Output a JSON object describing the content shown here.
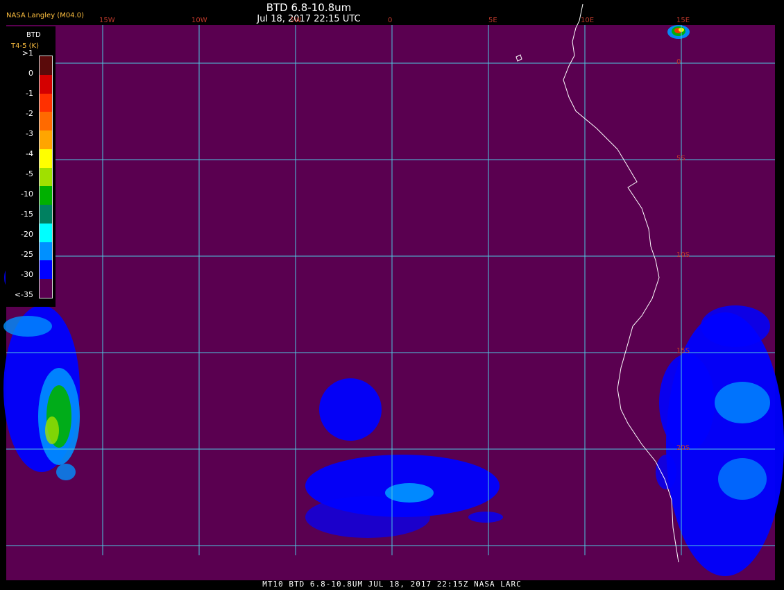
{
  "header": {
    "title": "BTD 6.8-10.8um",
    "timestamp": "Jul 18, 2017 22:15 UTC",
    "agency": "NASA Langley (M04.0)"
  },
  "footer": {
    "caption": "MT10  BTD 6.8-10.8UM   JUL 18, 2017 22:15Z   NASA LARC"
  },
  "legend": {
    "title_line1": "BTD",
    "title_line2": "T4-5 (K)",
    "ticks": [
      ">1",
      "0",
      "-1",
      "-2",
      "-3",
      "-4",
      "-5",
      "-10",
      "-15",
      "-20",
      "-25",
      "-30",
      "<-35"
    ],
    "colors": [
      "#5a0a0a",
      "#d40000",
      "#ff3000",
      "#ff6a00",
      "#ffa500",
      "#ffff00",
      "#a0e000",
      "#00b000",
      "#008060",
      "#00ffff",
      "#0090ff",
      "#0000ff",
      "#5a0050"
    ]
  },
  "map": {
    "background": "#5a0050",
    "grid_color": "#4fc8e0",
    "coast_color": "#ffffff",
    "lon_labels": [
      "15W",
      "10W",
      "5W",
      "0",
      "5E",
      "10E",
      "15E"
    ],
    "lat_labels": [
      "0",
      "5S",
      "10S",
      "15S",
      "20S"
    ]
  }
}
